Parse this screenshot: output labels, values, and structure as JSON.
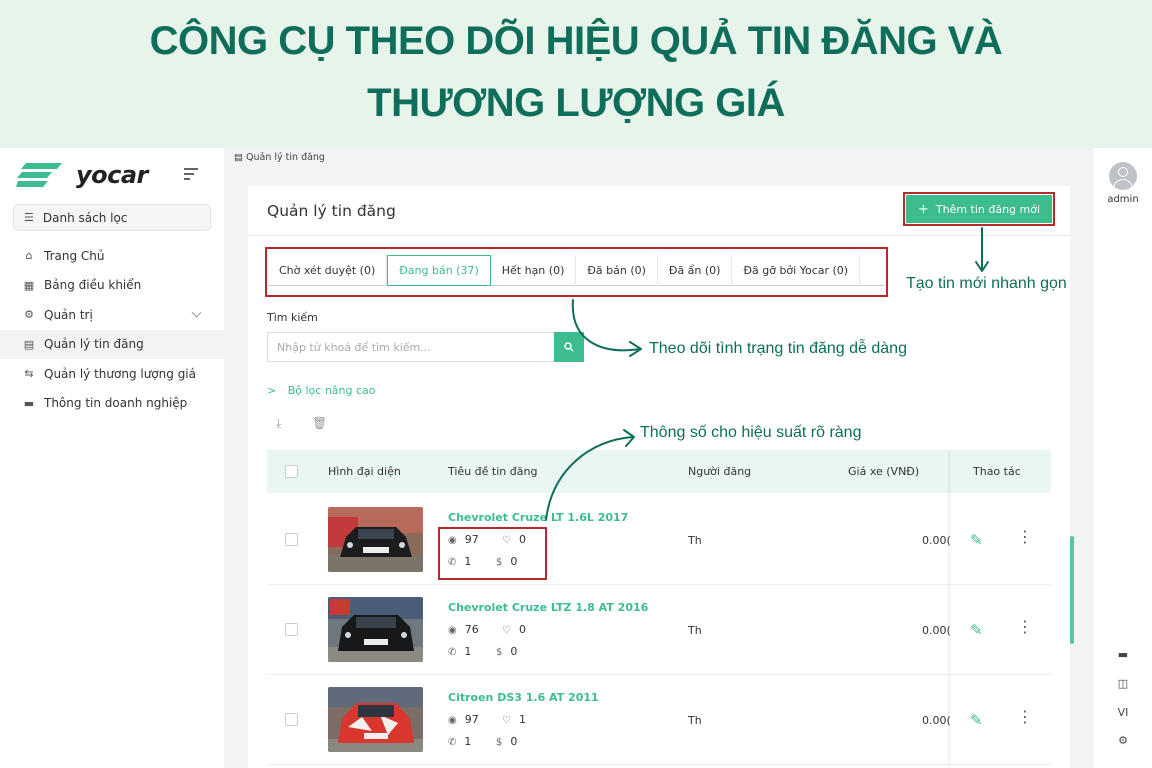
{
  "banner": {
    "line1": "CÔNG CỤ THEO DÕI HIỆU QUẢ TIN ĐĂNG VÀ",
    "line2": "THƯƠNG LƯỢNG GIÁ"
  },
  "sidebar": {
    "logo_text": "yocar",
    "filter_label": "Danh sách lọc",
    "items": [
      {
        "label": "Trang Chủ",
        "icon": "home-icon"
      },
      {
        "label": "Bảng điều khiển",
        "icon": "dashboard-icon"
      },
      {
        "label": "Quản trị",
        "icon": "settings-sliders-icon"
      },
      {
        "label": "Quản lý tin đăng",
        "icon": "document-icon"
      },
      {
        "label": "Quản lý thương lượng giá",
        "icon": "price-negotiation-icon"
      },
      {
        "label": "Thông tin doanh nghiệp",
        "icon": "car-icon"
      }
    ]
  },
  "breadcrumb": "Quản lý tin đăng",
  "page": {
    "title": "Quản lý tin đăng",
    "add_button": "Thêm tin đăng mới",
    "tabs": [
      "Chờ xét duyệt (0)",
      "Đang bán (37)",
      "Hết hạn (0)",
      "Đã bán (0)",
      "Đã ẩn (0)",
      "Đã gỡ bởi Yocar (0)"
    ],
    "search_label": "Tìm kiếm",
    "search_placeholder": "Nhập từ khoá để tìm kiếm...",
    "advanced_filter": "Bộ lọc nâng cao"
  },
  "table": {
    "headers": {
      "avatar": "Hình đại diện",
      "title": "Tiêu đề tin đăng",
      "poster": "Người đăng",
      "price": "Giá xe (VNĐ)",
      "actions": "Thao tác"
    },
    "rows": [
      {
        "title": "Chevrolet Cruze LT 1.6L 2017",
        "views": "97",
        "likes": "0",
        "calls": "1",
        "offers": "0",
        "poster": "Th",
        "price": "0.00("
      },
      {
        "title": "Chevrolet Cruze LTZ 1.8 AT 2016",
        "views": "76",
        "likes": "0",
        "calls": "1",
        "offers": "0",
        "poster": "Th",
        "price": "0.00("
      },
      {
        "title": "Citroen DS3 1.6 AT 2011",
        "views": "97",
        "likes": "1",
        "calls": "1",
        "offers": "0",
        "poster": "Th",
        "price": "0.00("
      }
    ]
  },
  "rightbar": {
    "user": "admin",
    "language": "VI"
  },
  "annotations": {
    "add_note": "Tạo tin mới nhanh gọn",
    "tabs_note": "Theo dõi tình trạng tin đăng dễ dàng",
    "stats_note": "Thông số cho hiệu suất rõ ràng"
  },
  "colors": {
    "accent": "#3dbd8e",
    "banner_bg": "#e6f4ea",
    "banner_text": "#0f6e5b",
    "highlight_border": "#b52b2b"
  }
}
